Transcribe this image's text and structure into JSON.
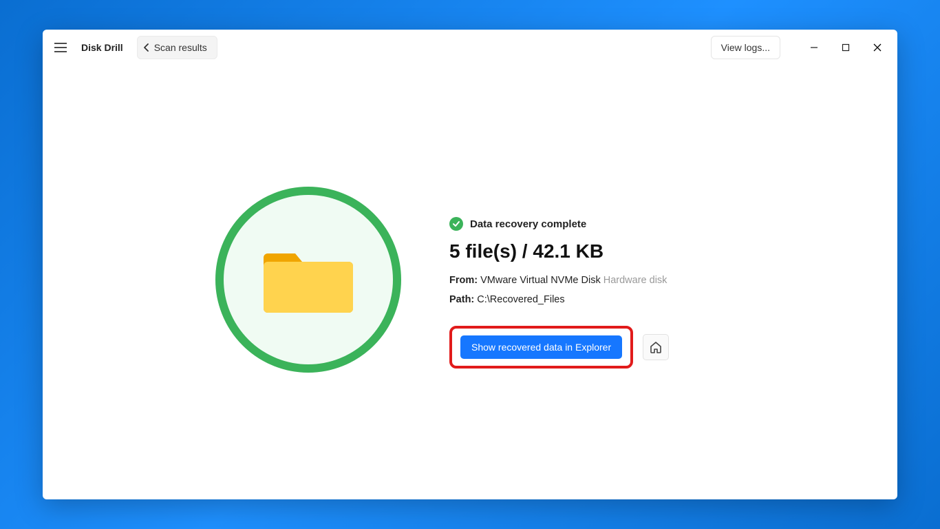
{
  "header": {
    "app_title": "Disk Drill",
    "back_label": "Scan results",
    "view_logs_label": "View logs..."
  },
  "result": {
    "status_text": "Data recovery complete",
    "summary": "5 file(s) / 42.1 KB",
    "from_label": "From:",
    "from_value": "VMware Virtual NVMe Disk",
    "from_extra": "Hardware disk",
    "path_label": "Path:",
    "path_value": "C:\\Recovered_Files",
    "show_btn_label": "Show recovered data in Explorer"
  }
}
